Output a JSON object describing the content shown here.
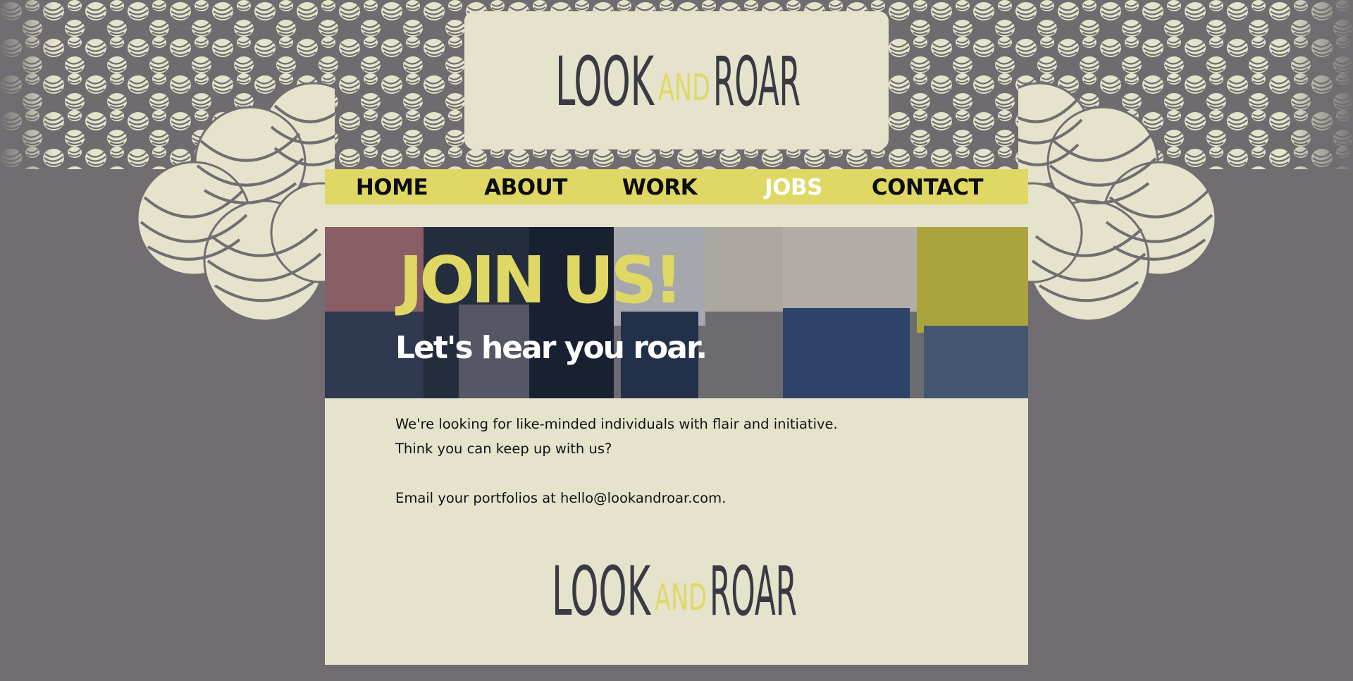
{
  "brand": {
    "logo_word_1": "LOOK",
    "logo_word_and": "AND",
    "logo_word_2": "ROAR"
  },
  "nav": {
    "items": [
      {
        "label": "HOME"
      },
      {
        "label": "ABOUT"
      },
      {
        "label": "WORK"
      },
      {
        "label": "JOBS",
        "active": true
      },
      {
        "label": "CONTACT"
      }
    ]
  },
  "hero": {
    "title": "JOIN US!",
    "subtitle": "Let's hear you roar."
  },
  "content": {
    "line_1": "We're looking for like-minded individuals with flair and initiative.",
    "line_2": "Think you can keep up with us?",
    "line_3": "Email your portfolios at hello@lookandroar.com."
  },
  "footer": {
    "logo_word_1": "LOOK",
    "logo_word_and": "AND",
    "logo_word_2": "ROAR"
  },
  "colors": {
    "background": "#716d71",
    "panel": "#e6e3cc",
    "accent_yellow": "#dfd865",
    "logo_dark": "#3a3a44"
  },
  "icons": {
    "pattern": "yarn-ball-pattern",
    "hero_image": "people-in-jeans-photo"
  }
}
